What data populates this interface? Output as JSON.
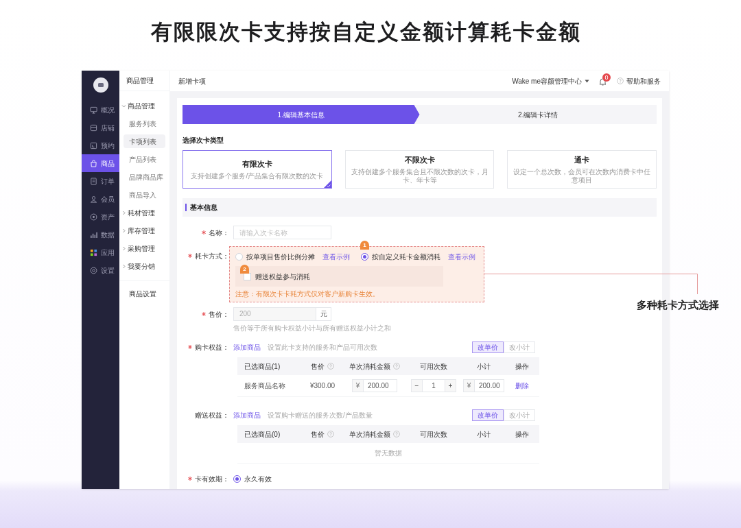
{
  "headline": "有限限次卡支持按自定义金额计算耗卡金额",
  "nav": [
    {
      "label": "概况",
      "selected": false
    },
    {
      "label": "店铺",
      "selected": false
    },
    {
      "label": "预约",
      "selected": false
    },
    {
      "label": "商品",
      "selected": true
    },
    {
      "label": "订单",
      "selected": false
    },
    {
      "label": "会员",
      "selected": false
    },
    {
      "label": "资产",
      "selected": false
    },
    {
      "label": "数据",
      "selected": false
    },
    {
      "label": "应用",
      "selected": false
    },
    {
      "label": "设置",
      "selected": false
    }
  ],
  "sub_sidebar": {
    "title": "商品管理",
    "groups": [
      {
        "label": "商品管理",
        "expanded": true,
        "children": [
          {
            "label": "服务列表",
            "selected": false
          },
          {
            "label": "卡项列表",
            "selected": true
          },
          {
            "label": "产品列表",
            "selected": false
          },
          {
            "label": "品牌商品库",
            "selected": false
          },
          {
            "label": "商品导入",
            "selected": false
          }
        ]
      },
      {
        "label": "耗材管理",
        "expanded": false
      },
      {
        "label": "库存管理",
        "expanded": false
      },
      {
        "label": "采购管理",
        "expanded": false
      },
      {
        "label": "我要分销",
        "expanded": false
      }
    ],
    "footer": "商品设置"
  },
  "header": {
    "breadcrumb": "新增卡项",
    "store": "Wake me容颜管理中心",
    "notification_badge": "0",
    "help": "帮助和服务"
  },
  "steps": [
    {
      "label": "1.编辑基本信息",
      "selected": true
    },
    {
      "label": "2.编辑卡详情",
      "selected": false
    }
  ],
  "card_type_title": "选择次卡类型",
  "card_types": [
    {
      "title": "有限次卡",
      "description": "支持创建多个服务/产品集合有限次数的次卡",
      "selected": true
    },
    {
      "title": "不限次卡",
      "description": "支持创建多个服务集合且不限次数的次卡，月卡、年卡等",
      "selected": false
    },
    {
      "title": "通卡",
      "description": "设定一个总次数，会员可在次数内消费卡中任意项目",
      "selected": false
    }
  ],
  "section_title": "基本信息",
  "form": {
    "name": {
      "label": "名称：",
      "required": true,
      "placeholder": "请输入次卡名称"
    },
    "consume": {
      "label": "耗卡方式：",
      "required": true,
      "options": [
        {
          "label": "按单项目售价比例分摊",
          "link": "查看示例",
          "selected": false
        },
        {
          "label": "按自定义耗卡金额消耗",
          "link": "查看示例",
          "selected": true
        }
      ],
      "checkbox": {
        "label": "赠送权益参与消耗",
        "checked": false
      },
      "note": "注意：有限次卡卡耗方式仅对客户新购卡生效。",
      "markers": [
        "1",
        "2"
      ]
    },
    "price": {
      "label": "售价：",
      "required": true,
      "value": "200",
      "unit": "元",
      "hint": "售价等于所有购卡权益小计与所有赠送权益小计之和"
    },
    "benefits": [
      {
        "label": "购卡权益：",
        "required": true,
        "add": "添加商品",
        "hint": "设置此卡支持的服务和产品可用次数",
        "toggle": [
          {
            "label": "改单价",
            "selected": true
          },
          {
            "label": "改小计",
            "selected": false
          }
        ],
        "columns": [
          {
            "label": "已选商品(1)",
            "help": false
          },
          {
            "label": "售价",
            "help": true
          },
          {
            "label": "单次消耗金额",
            "help": true
          },
          {
            "label": "可用次数",
            "help": false
          },
          {
            "label": "小计",
            "help": false
          },
          {
            "label": "操作",
            "help": false
          }
        ],
        "rows": [
          {
            "name": "服务商品名称",
            "price": "¥300.00",
            "amount_currency": "¥",
            "amount": "200.00",
            "minus": "−",
            "count": "1",
            "plus": "+",
            "subtotal_currency": "¥",
            "subtotal": "200.00",
            "action": "删除"
          }
        ]
      },
      {
        "label": "赠送权益：",
        "required": false,
        "add": "添加商品",
        "hint": "设置购卡赠送的服务次数/产品数量",
        "toggle": [
          {
            "label": "改单价",
            "selected": true
          },
          {
            "label": "改小计",
            "selected": false
          }
        ],
        "columns": [
          {
            "label": "已选商品(0)",
            "help": false
          },
          {
            "label": "售价",
            "help": true
          },
          {
            "label": "单次消耗金额",
            "help": true
          },
          {
            "label": "可用次数",
            "help": false
          },
          {
            "label": "小计",
            "help": false
          },
          {
            "label": "操作",
            "help": false
          }
        ],
        "empty": "暂无数据"
      }
    ],
    "validity": {
      "label": "卡有效期：",
      "required": true,
      "options": [
        {
          "label": "永久有效",
          "selected": true
        }
      ]
    }
  },
  "callout": "多种耗卡方式选择"
}
